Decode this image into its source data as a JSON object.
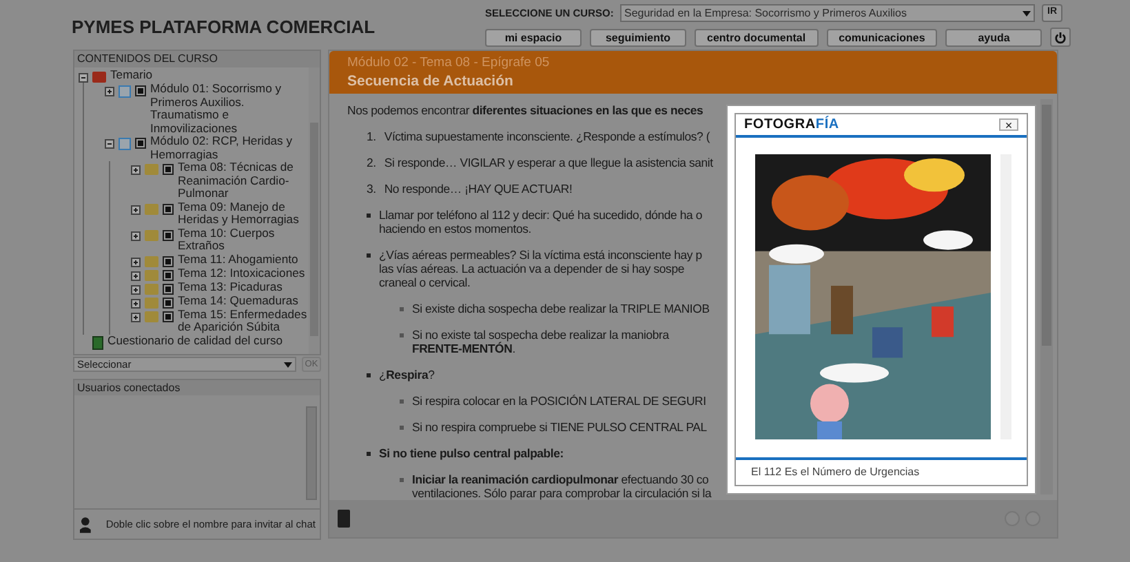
{
  "header": {
    "title": "PYMES PLATAFORMA COMERCIAL",
    "course_label": "SELECCIONE UN CURSO:",
    "course_value": "Seguridad en la Empresa: Socorrismo y Primeros Auxilios",
    "go_button": "IR",
    "nav": [
      "mi espacio",
      "seguimiento",
      "centro documental",
      "comunicaciones",
      "ayuda"
    ]
  },
  "sidebar": {
    "title": "CONTENIDOS DEL CURSO",
    "tree": [
      {
        "kind": "root",
        "label": "Temario",
        "expanded": true,
        "children": [
          {
            "kind": "module",
            "label": "Módulo 01: Socorrismo y Primeros Auxilios. Traumatismo e Inmovilizaciones",
            "expanded": false,
            "checked": true
          },
          {
            "kind": "module",
            "label": "Módulo 02: RCP, Heridas y Hemorragias",
            "expanded": true,
            "checked": true,
            "children": [
              {
                "kind": "topic",
                "label": "Tema 08: Técnicas de Reanimación Cardio-Pulmonar",
                "expanded": false,
                "checked": true
              },
              {
                "kind": "topic",
                "label": "Tema 09: Manejo de Heridas y Hemorragias",
                "expanded": false,
                "checked": true
              },
              {
                "kind": "topic",
                "label": "Tema 10: Cuerpos Extraños",
                "expanded": false,
                "checked": true
              },
              {
                "kind": "topic",
                "label": "Tema 11: Ahogamiento",
                "expanded": false,
                "checked": true
              },
              {
                "kind": "topic",
                "label": "Tema 12: Intoxicaciones",
                "expanded": false,
                "checked": true
              },
              {
                "kind": "topic",
                "label": "Tema 13: Picaduras",
                "expanded": false,
                "checked": true
              },
              {
                "kind": "topic",
                "label": "Tema 14: Quemaduras",
                "expanded": false,
                "checked": true
              },
              {
                "kind": "topic",
                "label": "Tema 15: Enfermedades de Aparición Súbita",
                "expanded": false,
                "checked": true
              }
            ]
          }
        ]
      },
      {
        "kind": "quiz",
        "label": "Cuestionario de calidad del curso"
      }
    ],
    "select": "Seleccionar",
    "ok_button": "OK",
    "ok_disabled": true,
    "users_title": "Usuarios conectados",
    "chat_hint": "Doble clic sobre el nombre para invitar al chat"
  },
  "main": {
    "breadcrumb": "Módulo 02 - Tema 08 - Epígrafe 05",
    "title": "Secuencia de Actuación",
    "content": [
      {
        "kind": "para",
        "lines": [
          "Nos podemos encontrar **diferentes situaciones en las que es neces**"
        ]
      },
      {
        "kind": "num",
        "marker": "1.",
        "lines": [
          "Víctima supuestamente inconsciente. ¿Responde a estímulos? ("
        ]
      },
      {
        "kind": "num",
        "marker": "2.",
        "lines": [
          "Si responde… VIGILAR y esperar a que llegue la asistencia sanit"
        ]
      },
      {
        "kind": "num",
        "marker": "3.",
        "lines": [
          "No responde… ¡HAY QUE ACTUAR!"
        ]
      },
      {
        "kind": "bullet",
        "lines": [
          "Llamar por teléfono al 112 y decir: Qué ha sucedido, dónde ha o",
          "haciendo en estos momentos."
        ]
      },
      {
        "kind": "bullet",
        "lines": [
          "¿Vías aéreas permeables? Si la víctima está inconsciente hay p",
          "las vías aéreas. La actuación va a depender de si hay sospe",
          "craneal o cervical."
        ]
      },
      {
        "kind": "sub",
        "lines": [
          "Si existe dicha sospecha debe realizar la TRIPLE MANIOB"
        ]
      },
      {
        "kind": "sub",
        "lines": [
          "Si no existe tal sospecha debe realizar la maniobra",
          "**FRENTE-MENTÓN**."
        ]
      },
      {
        "kind": "bullet",
        "lines": [
          "¿**Respira**?"
        ]
      },
      {
        "kind": "sub",
        "lines": [
          "Si respira colocar en la POSICIÓN LATERAL DE SEGURI"
        ]
      },
      {
        "kind": "sub",
        "lines": [
          "Si no respira compruebe si TIENE PULSO CENTRAL PAL"
        ]
      },
      {
        "kind": "bullet",
        "bold": true,
        "lines": [
          "Si no tiene pulso central palpable:"
        ]
      },
      {
        "kind": "sub",
        "lines": [
          "**Iniciar la reanimación cardiopulmonar** efectuando 30 co",
          "ventilaciones. Sólo parar para comprobar la circulación si la"
        ]
      }
    ]
  },
  "modal": {
    "title": {
      "plain": "FOTOGRA",
      "accent": "FÍA"
    },
    "close": "×",
    "caption": "El 112 Es el Número de Urgencias"
  }
}
